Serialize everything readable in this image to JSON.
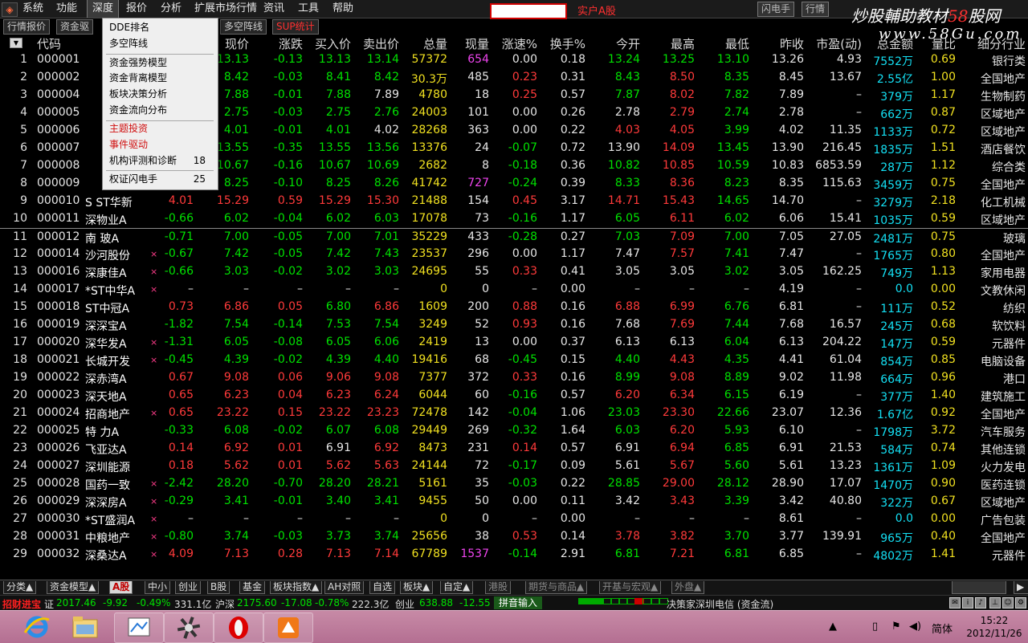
{
  "menubar": {
    "items": [
      "系统",
      "功能",
      "深度",
      "报价",
      "分析",
      "扩展市场行情",
      "资讯",
      "工具",
      "帮助"
    ],
    "active_index": 2,
    "account_label": "实户A股",
    "right_buttons": [
      "闪电手",
      "行情"
    ]
  },
  "watermark": {
    "text": "炒股輔助教材",
    "number": "58",
    "suffix": "股网",
    "url": "www.58Gu.com"
  },
  "subtabs": [
    {
      "label": "行情报价",
      "red": false
    },
    {
      "label": "资金驱",
      "red": false
    },
    {
      "label": "多空阵线",
      "red": false
    },
    {
      "label": "SUP统计",
      "red": true
    }
  ],
  "dropdown": {
    "groups": [
      [
        {
          "label": "DDE排名",
          "shortcut": ""
        },
        {
          "label": "多空阵线",
          "shortcut": ""
        }
      ],
      [
        {
          "label": "资金强势模型",
          "shortcut": ""
        },
        {
          "label": "资金背离模型",
          "shortcut": ""
        },
        {
          "label": "板块决策分析",
          "shortcut": ""
        },
        {
          "label": "资金流向分布",
          "shortcut": ""
        }
      ],
      [
        {
          "label": "主题投资",
          "shortcut": "",
          "red": true
        },
        {
          "label": "事件驱动",
          "shortcut": "",
          "red": true
        },
        {
          "label": "机构评测和诊断",
          "shortcut": "18"
        }
      ],
      [
        {
          "label": "权证闪电手",
          "shortcut": "25"
        }
      ]
    ]
  },
  "table": {
    "headers": [
      "代码",
      "现价",
      "涨跌",
      "买入价",
      "卖出价",
      "总量",
      "现量",
      "涨速%",
      "换手%",
      "今开",
      "最高",
      "最低",
      "昨收",
      "市盈(动)",
      "总金额",
      "量比",
      "细分行业"
    ],
    "rows": [
      {
        "seq": "1",
        "code": "000001",
        "name": "",
        "mark": "",
        "zf": "",
        "xj": "13.13",
        "zd": "-0.13",
        "mr": "13.13",
        "mc": "13.14",
        "zl": "57372",
        "xl": "654",
        "zs": "0.00",
        "hs": "0.18",
        "jk": "13.24",
        "zg": "13.25",
        "zdi": "13.10",
        "zs2": "13.26",
        "syl": "4.93",
        "zje": "7552万",
        "lb": "0.69",
        "hy": "银行类"
      },
      {
        "seq": "2",
        "code": "000002",
        "name": "",
        "mark": "",
        "zf": "",
        "xj": "8.42",
        "zd": "-0.03",
        "mr": "8.41",
        "mc": "8.42",
        "zl": "30.3万",
        "xl": "485",
        "zs": "0.23",
        "hs": "0.31",
        "jk": "8.43",
        "zg": "8.50",
        "zdi": "8.35",
        "zs2": "8.45",
        "syl": "13.67",
        "zje": "2.55亿",
        "lb": "1.00",
        "hy": "全国地产"
      },
      {
        "seq": "3",
        "code": "000004",
        "name": "",
        "mark": "",
        "zf": "",
        "xj": "7.88",
        "zd": "-0.01",
        "mr": "7.88",
        "mc": "7.89",
        "zl": "4780",
        "xl": "18",
        "zs": "0.25",
        "hs": "0.57",
        "jk": "7.87",
        "zg": "8.02",
        "zdi": "7.82",
        "zs2": "7.89",
        "syl": "–",
        "zje": "379万",
        "lb": "1.17",
        "hy": "生物制药"
      },
      {
        "seq": "4",
        "code": "000005",
        "name": "",
        "mark": "",
        "zf": "",
        "xj": "2.75",
        "zd": "-0.03",
        "mr": "2.75",
        "mc": "2.76",
        "zl": "24003",
        "xl": "101",
        "zs": "0.00",
        "hs": "0.26",
        "jk": "2.78",
        "zg": "2.79",
        "zdi": "2.74",
        "zs2": "2.78",
        "syl": "–",
        "zje": "662万",
        "lb": "0.87",
        "hy": "区域地产"
      },
      {
        "seq": "5",
        "code": "000006",
        "name": "",
        "mark": "",
        "zf": "",
        "xj": "4.01",
        "zd": "-0.01",
        "mr": "4.01",
        "mc": "4.02",
        "zl": "28268",
        "xl": "363",
        "zs": "0.00",
        "hs": "0.22",
        "jk": "4.03",
        "zg": "4.05",
        "zdi": "3.99",
        "zs2": "4.02",
        "syl": "11.35",
        "zje": "1133万",
        "lb": "0.72",
        "hy": "区域地产"
      },
      {
        "seq": "6",
        "code": "000007",
        "name": "",
        "mark": "",
        "zf": "",
        "xj": "13.55",
        "zd": "-0.35",
        "mr": "13.55",
        "mc": "13.56",
        "zl": "13376",
        "xl": "24",
        "zs": "-0.07",
        "hs": "0.72",
        "jk": "13.90",
        "zg": "14.09",
        "zdi": "13.45",
        "zs2": "13.90",
        "syl": "216.45",
        "zje": "1835万",
        "lb": "1.51",
        "hy": "酒店餐饮"
      },
      {
        "seq": "7",
        "code": "000008",
        "name": "",
        "mark": "",
        "zf": "",
        "xj": "10.67",
        "zd": "-0.16",
        "mr": "10.67",
        "mc": "10.69",
        "zl": "2682",
        "xl": "8",
        "zs": "-0.18",
        "hs": "0.36",
        "jk": "10.82",
        "zg": "10.85",
        "zdi": "10.59",
        "zs2": "10.83",
        "syl": "6853.59",
        "zje": "287万",
        "lb": "1.12",
        "hy": "综合类"
      },
      {
        "seq": "8",
        "code": "000009",
        "name": "",
        "mark": "",
        "zf": "",
        "xj": "8.25",
        "zd": "-0.10",
        "mr": "8.25",
        "mc": "8.26",
        "zl": "41742",
        "xl": "727",
        "zs": "-0.24",
        "hs": "0.39",
        "jk": "8.33",
        "zg": "8.36",
        "zdi": "8.23",
        "zs2": "8.35",
        "syl": "115.63",
        "zje": "3459万",
        "lb": "0.75",
        "hy": "全国地产"
      },
      {
        "seq": "9",
        "code": "000010",
        "name": "S ST华新",
        "mark": "",
        "zf": "4.01",
        "xj": "15.29",
        "zd": "0.59",
        "mr": "15.29",
        "mc": "15.30",
        "zl": "21488",
        "xl": "154",
        "zs": "0.45",
        "hs": "3.17",
        "jk": "14.71",
        "zg": "15.43",
        "zdi": "14.65",
        "zs2": "14.70",
        "syl": "–",
        "zje": "3279万",
        "lb": "2.18",
        "hy": "化工机械"
      },
      {
        "seq": "10",
        "code": "000011",
        "name": "深物业A",
        "mark": "",
        "zf": "-0.66",
        "xj": "6.02",
        "zd": "-0.04",
        "mr": "6.02",
        "mc": "6.03",
        "zl": "17078",
        "xl": "73",
        "zs": "-0.16",
        "hs": "1.17",
        "jk": "6.05",
        "zg": "6.11",
        "zdi": "6.02",
        "zs2": "6.06",
        "syl": "15.41",
        "zje": "1035万",
        "lb": "0.59",
        "hy": "区域地产"
      },
      {
        "seq": "11",
        "code": "000012",
        "name": "南 玻A",
        "mark": "",
        "zf": "-0.71",
        "xj": "7.00",
        "zd": "-0.05",
        "mr": "7.00",
        "mc": "7.01",
        "zl": "35229",
        "xl": "433",
        "zs": "-0.28",
        "hs": "0.27",
        "jk": "7.03",
        "zg": "7.09",
        "zdi": "7.00",
        "zs2": "7.05",
        "syl": "27.05",
        "zje": "2481万",
        "lb": "0.75",
        "hy": "玻璃"
      },
      {
        "seq": "12",
        "code": "000014",
        "name": "沙河股份",
        "mark": "×",
        "zf": "-0.67",
        "xj": "7.42",
        "zd": "-0.05",
        "mr": "7.42",
        "mc": "7.43",
        "zl": "23537",
        "xl": "296",
        "zs": "0.00",
        "hs": "1.17",
        "jk": "7.47",
        "zg": "7.57",
        "zdi": "7.41",
        "zs2": "7.47",
        "syl": "–",
        "zje": "1765万",
        "lb": "0.80",
        "hy": "全国地产"
      },
      {
        "seq": "13",
        "code": "000016",
        "name": "深康佳A",
        "mark": "×",
        "zf": "-0.66",
        "xj": "3.03",
        "zd": "-0.02",
        "mr": "3.02",
        "mc": "3.03",
        "zl": "24695",
        "xl": "55",
        "zs": "0.33",
        "hs": "0.41",
        "jk": "3.05",
        "zg": "3.05",
        "zdi": "3.02",
        "zs2": "3.05",
        "syl": "162.25",
        "zje": "749万",
        "lb": "1.13",
        "hy": "家用电器"
      },
      {
        "seq": "14",
        "code": "000017",
        "name": "*ST中华A",
        "mark": "×",
        "zf": "–",
        "xj": "–",
        "zd": "–",
        "mr": "–",
        "mc": "–",
        "zl": "0",
        "xl": "0",
        "zs": "–",
        "hs": "0.00",
        "jk": "–",
        "zg": "–",
        "zdi": "–",
        "zs2": "4.19",
        "syl": "–",
        "zje": "0.0",
        "lb": "0.00",
        "hy": "文教休闲"
      },
      {
        "seq": "15",
        "code": "000018",
        "name": "ST中冠A",
        "mark": "",
        "zf": "0.73",
        "xj": "6.86",
        "zd": "0.05",
        "mr": "6.80",
        "mc": "6.86",
        "zl": "1609",
        "xl": "200",
        "zs": "0.88",
        "hs": "0.16",
        "jk": "6.88",
        "zg": "6.99",
        "zdi": "6.76",
        "zs2": "6.81",
        "syl": "–",
        "zje": "111万",
        "lb": "0.52",
        "hy": "纺织"
      },
      {
        "seq": "16",
        "code": "000019",
        "name": "深深宝A",
        "mark": "",
        "zf": "-1.82",
        "xj": "7.54",
        "zd": "-0.14",
        "mr": "7.53",
        "mc": "7.54",
        "zl": "3249",
        "xl": "52",
        "zs": "0.93",
        "hs": "0.16",
        "jk": "7.68",
        "zg": "7.69",
        "zdi": "7.44",
        "zs2": "7.68",
        "syl": "16.57",
        "zje": "245万",
        "lb": "0.68",
        "hy": "软饮料"
      },
      {
        "seq": "17",
        "code": "000020",
        "name": "深华发A",
        "mark": "×",
        "zf": "-1.31",
        "xj": "6.05",
        "zd": "-0.08",
        "mr": "6.05",
        "mc": "6.06",
        "zl": "2419",
        "xl": "13",
        "zs": "0.00",
        "hs": "0.37",
        "jk": "6.13",
        "zg": "6.13",
        "zdi": "6.04",
        "zs2": "6.13",
        "syl": "204.22",
        "zje": "147万",
        "lb": "0.59",
        "hy": "元器件"
      },
      {
        "seq": "18",
        "code": "000021",
        "name": "长城开发",
        "mark": "×",
        "zf": "-0.45",
        "xj": "4.39",
        "zd": "-0.02",
        "mr": "4.39",
        "mc": "4.40",
        "zl": "19416",
        "xl": "68",
        "zs": "-0.45",
        "hs": "0.15",
        "jk": "4.40",
        "zg": "4.43",
        "zdi": "4.35",
        "zs2": "4.41",
        "syl": "61.04",
        "zje": "854万",
        "lb": "0.85",
        "hy": "电脑设备"
      },
      {
        "seq": "19",
        "code": "000022",
        "name": "深赤湾A",
        "mark": "",
        "zf": "0.67",
        "xj": "9.08",
        "zd": "0.06",
        "mr": "9.06",
        "mc": "9.08",
        "zl": "7377",
        "xl": "372",
        "zs": "0.33",
        "hs": "0.16",
        "jk": "8.99",
        "zg": "9.08",
        "zdi": "8.89",
        "zs2": "9.02",
        "syl": "11.98",
        "zje": "664万",
        "lb": "0.96",
        "hy": "港口"
      },
      {
        "seq": "20",
        "code": "000023",
        "name": "深天地A",
        "mark": "",
        "zf": "0.65",
        "xj": "6.23",
        "zd": "0.04",
        "mr": "6.23",
        "mc": "6.24",
        "zl": "6044",
        "xl": "60",
        "zs": "-0.16",
        "hs": "0.57",
        "jk": "6.20",
        "zg": "6.34",
        "zdi": "6.15",
        "zs2": "6.19",
        "syl": "–",
        "zje": "377万",
        "lb": "1.40",
        "hy": "建筑施工"
      },
      {
        "seq": "21",
        "code": "000024",
        "name": "招商地产",
        "mark": "×",
        "zf": "0.65",
        "xj": "23.22",
        "zd": "0.15",
        "mr": "23.22",
        "mc": "23.23",
        "zl": "72478",
        "xl": "142",
        "zs": "-0.04",
        "hs": "1.06",
        "jk": "23.03",
        "zg": "23.30",
        "zdi": "22.66",
        "zs2": "23.07",
        "syl": "12.36",
        "zje": "1.67亿",
        "lb": "0.92",
        "hy": "全国地产"
      },
      {
        "seq": "22",
        "code": "000025",
        "name": "特 力A",
        "mark": "",
        "zf": "-0.33",
        "xj": "6.08",
        "zd": "-0.02",
        "mr": "6.07",
        "mc": "6.08",
        "zl": "29449",
        "xl": "269",
        "zs": "-0.32",
        "hs": "1.64",
        "jk": "6.03",
        "zg": "6.20",
        "zdi": "5.93",
        "zs2": "6.10",
        "syl": "–",
        "zje": "1798万",
        "lb": "3.72",
        "hy": "汽车服务"
      },
      {
        "seq": "23",
        "code": "000026",
        "name": "飞亚达A",
        "mark": "",
        "zf": "0.14",
        "xj": "6.92",
        "zd": "0.01",
        "mr": "6.91",
        "mc": "6.92",
        "zl": "8473",
        "xl": "231",
        "zs": "0.14",
        "hs": "0.57",
        "jk": "6.91",
        "zg": "6.94",
        "zdi": "6.85",
        "zs2": "6.91",
        "syl": "21.53",
        "zje": "584万",
        "lb": "0.74",
        "hy": "其他连锁"
      },
      {
        "seq": "24",
        "code": "000027",
        "name": "深圳能源",
        "mark": "",
        "zf": "0.18",
        "xj": "5.62",
        "zd": "0.01",
        "mr": "5.62",
        "mc": "5.63",
        "zl": "24144",
        "xl": "72",
        "zs": "-0.17",
        "hs": "0.09",
        "jk": "5.61",
        "zg": "5.67",
        "zdi": "5.60",
        "zs2": "5.61",
        "syl": "13.23",
        "zje": "1361万",
        "lb": "1.09",
        "hy": "火力发电"
      },
      {
        "seq": "25",
        "code": "000028",
        "name": "国药一致",
        "mark": "×",
        "zf": "-2.42",
        "xj": "28.20",
        "zd": "-0.70",
        "mr": "28.20",
        "mc": "28.21",
        "zl": "5161",
        "xl": "35",
        "zs": "-0.03",
        "hs": "0.22",
        "jk": "28.85",
        "zg": "29.00",
        "zdi": "28.12",
        "zs2": "28.90",
        "syl": "17.07",
        "zje": "1470万",
        "lb": "0.90",
        "hy": "医药连锁"
      },
      {
        "seq": "26",
        "code": "000029",
        "name": "深深房A",
        "mark": "×",
        "zf": "-0.29",
        "xj": "3.41",
        "zd": "-0.01",
        "mr": "3.40",
        "mc": "3.41",
        "zl": "9455",
        "xl": "50",
        "zs": "0.00",
        "hs": "0.11",
        "jk": "3.42",
        "zg": "3.43",
        "zdi": "3.39",
        "zs2": "3.42",
        "syl": "40.80",
        "zje": "322万",
        "lb": "0.67",
        "hy": "区域地产"
      },
      {
        "seq": "27",
        "code": "000030",
        "name": "*ST盛润A",
        "mark": "×",
        "zf": "–",
        "xj": "–",
        "zd": "–",
        "mr": "–",
        "mc": "–",
        "zl": "0",
        "xl": "0",
        "zs": "–",
        "hs": "0.00",
        "jk": "–",
        "zg": "–",
        "zdi": "–",
        "zs2": "8.61",
        "syl": "–",
        "zje": "0.0",
        "lb": "0.00",
        "hy": "广告包装"
      },
      {
        "seq": "28",
        "code": "000031",
        "name": "中粮地产",
        "mark": "×",
        "zf": "-0.80",
        "xj": "3.74",
        "zd": "-0.03",
        "mr": "3.73",
        "mc": "3.74",
        "zl": "25656",
        "xl": "38",
        "zs": "0.53",
        "hs": "0.14",
        "jk": "3.78",
        "zg": "3.82",
        "zdi": "3.70",
        "zs2": "3.77",
        "syl": "139.91",
        "zje": "965万",
        "lb": "0.40",
        "hy": "全国地产"
      },
      {
        "seq": "29",
        "code": "000032",
        "name": "深桑达A",
        "mark": "×",
        "zf": "4.09",
        "xj": "7.13",
        "zd": "0.28",
        "mr": "7.13",
        "mc": "7.14",
        "zl": "67789",
        "xl": "1537",
        "zs": "-0.14",
        "hs": "2.91",
        "jk": "6.81",
        "zg": "7.21",
        "zdi": "6.81",
        "zs2": "6.85",
        "syl": "–",
        "zje": "4802万",
        "lb": "1.41",
        "hy": "元器件"
      }
    ]
  },
  "bottom_tabs": [
    "分类▲",
    "资金模型▲",
    "A股",
    "中小",
    "创业",
    "B股",
    "基金",
    "板块指数▲",
    "AH对照",
    "自选",
    "板块▲",
    "自定▲",
    "港股",
    "期货与商品▲",
    "开基与宏观▲",
    "外盘▲"
  ],
  "status": {
    "label1": "招财进宝",
    "sh_name": "证",
    "sh_val": "2017.46",
    "sh_chg": "-9.92",
    "sh_pct": "-0.49%",
    "sh_amt": "331.1亿",
    "sz_name": "沪深",
    "sz_val": "2175.60",
    "sz_chg": "-17.08",
    "sz_pct": "-0.78%",
    "sz_amt": "222.3亿",
    "cy_name": "创业",
    "cy_val": "638.88",
    "cy_chg": "-12.55",
    "ime": "拼音输入",
    "server": "决策家深圳电信 (资金流)"
  },
  "taskbar": {
    "apps": [
      "internet-explorer",
      "file-explorer",
      "paint",
      "app-gear",
      "opera",
      "trading-app"
    ],
    "tray_lang": "简体",
    "time": "15:22",
    "date": "2012/11/26"
  }
}
